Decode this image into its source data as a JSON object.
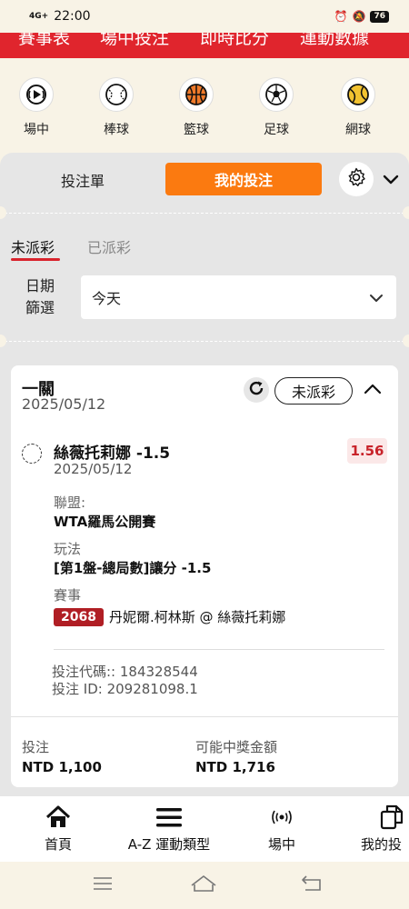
{
  "status_bar": {
    "network": "4G+",
    "time": "22:00",
    "battery": "76"
  },
  "top_nav": {
    "items": [
      "賽事表",
      "場中投注",
      "即時比分",
      "運動數據"
    ]
  },
  "sports": [
    {
      "label": "場中",
      "icon": "live-icon"
    },
    {
      "label": "棒球",
      "icon": "baseball-icon"
    },
    {
      "label": "籃球",
      "icon": "basketball-icon"
    },
    {
      "label": "足球",
      "icon": "soccer-icon"
    },
    {
      "label": "網球",
      "icon": "tennis-icon"
    }
  ],
  "bet_panel": {
    "tab_slip": "投注單",
    "tab_my_bets": "我的投注",
    "sub_tabs": {
      "unsettled": "未派彩",
      "settled": "已派彩"
    },
    "date_filter_label": "日期篩選",
    "date_filter_line1": "日期",
    "date_filter_line2": "篩選",
    "date_filter_value": "今天"
  },
  "bet_card": {
    "title": "一關",
    "date": "2025/05/12",
    "status": "未派彩",
    "selection": "絲薇托莉娜 -1.5",
    "selection_date": "2025/05/12",
    "odds": "1.56",
    "league_label": "聯盟:",
    "league_value": "WTA羅馬公開賽",
    "market_label": "玩法",
    "market_value": "[第1盤-總局數]讓分 -1.5",
    "event_label": "賽事",
    "event_id": "2068",
    "event_name": "丹妮爾.柯林斯 @ 絲薇托莉娜",
    "bet_code": "投注代碼:: 184328544",
    "bet_id": "投注 ID: 209281098.1",
    "stake_label": "投注",
    "stake_value": "NTD 1,100",
    "payout_label": "可能中獎金額",
    "payout_value": "NTD 1,716"
  },
  "bottom_nav": [
    {
      "label": "首頁",
      "icon": "home-icon"
    },
    {
      "label": "A-Z 運動類型",
      "icon": "menu-icon"
    },
    {
      "label": "場中",
      "icon": "live-icon"
    },
    {
      "label": "我的投",
      "icon": "my-bets-icon"
    }
  ],
  "colors": {
    "brand_red": "#e0252d",
    "accent_orange": "#fb7a10",
    "odds_red": "#c8232a"
  }
}
